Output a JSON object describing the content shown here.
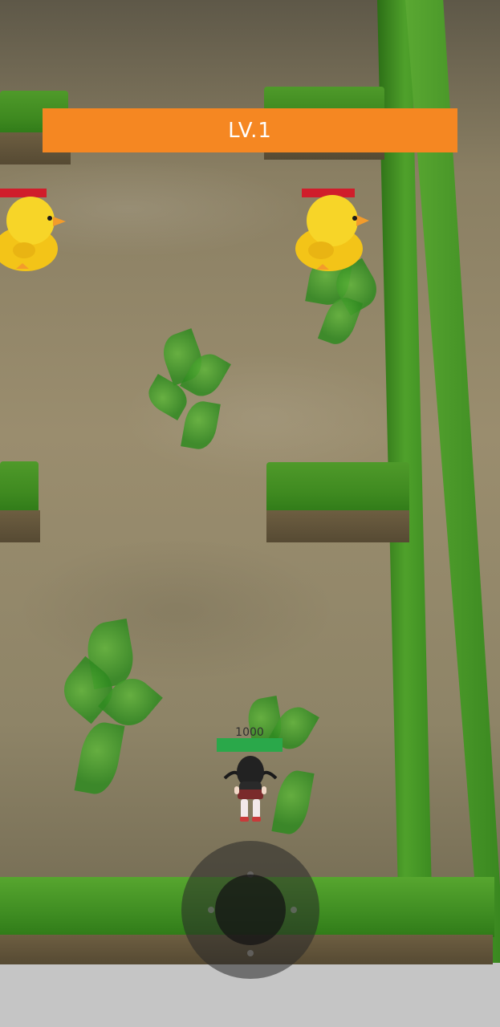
{
  "hud": {
    "level_label": "LV.1"
  },
  "player": {
    "hp_text": "1000",
    "hp_fraction": 1.0
  },
  "enemies": [
    {
      "name": "chick-left",
      "hp_fraction": 1.0
    },
    {
      "name": "chick-right",
      "hp_fraction": 1.0
    }
  ],
  "colors": {
    "banner": "#f58722",
    "player_hp": "#2aa84a",
    "enemy_hp": "#d01d2b",
    "hedge": "#3f8a20",
    "ground": "#8e8467",
    "background": "#c5c5c5"
  },
  "icons": [
    "chick-enemy-icon",
    "player-character-icon",
    "virtual-joystick-icon"
  ]
}
